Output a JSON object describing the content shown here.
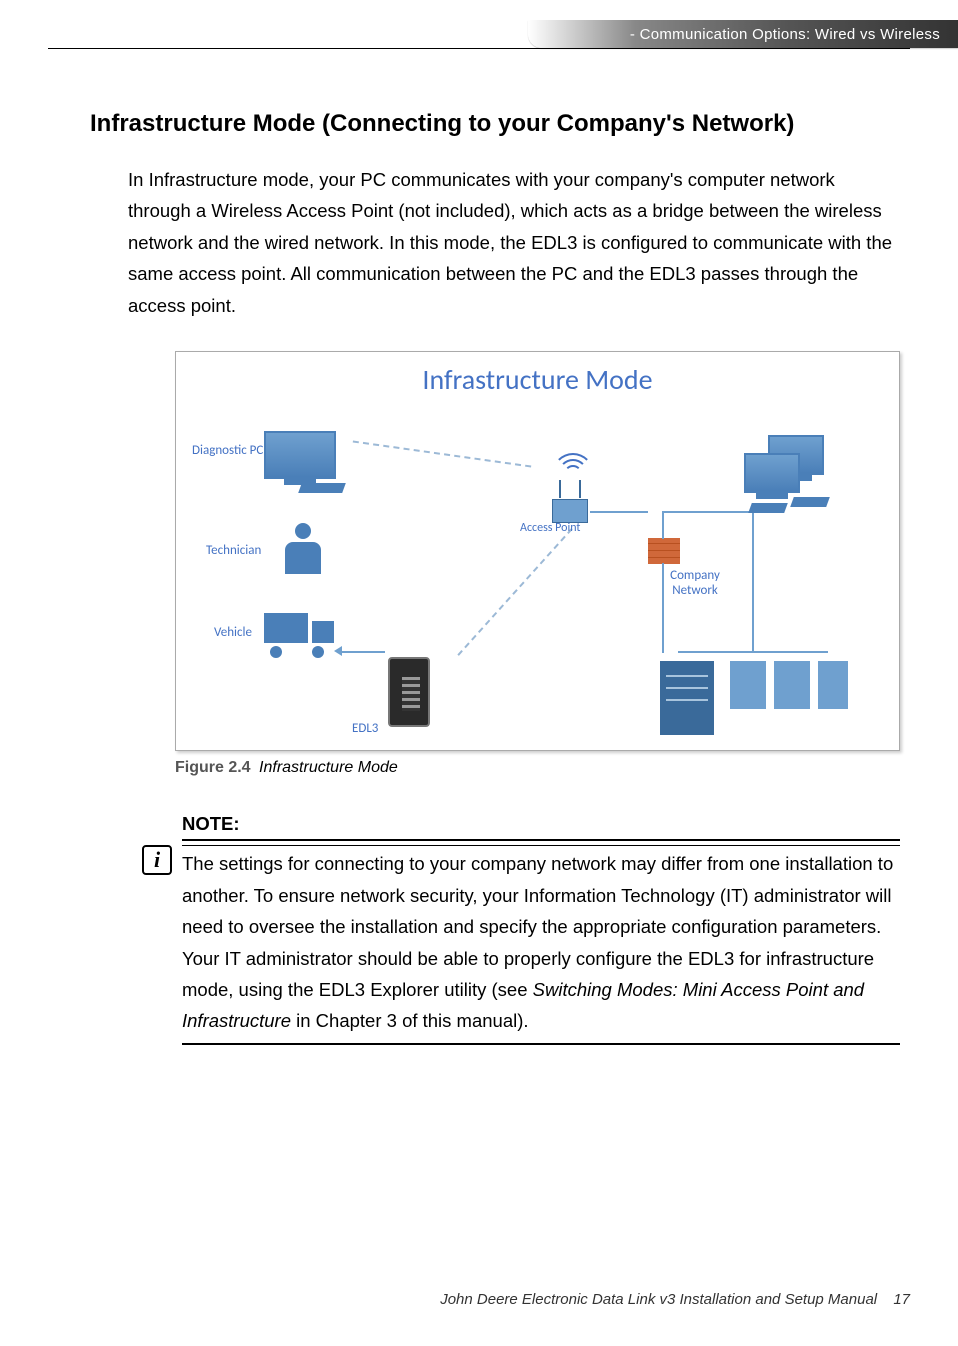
{
  "header": {
    "breadcrumb": "- Communication Options: Wired vs Wireless"
  },
  "section": {
    "title": "Infrastructure Mode (Connecting to your Company's Network)",
    "paragraph": "In Infrastructure mode, your PC communicates with your company's computer network through a Wireless Access Point (not included), which acts as a bridge between the wireless network and the wired network.  In this mode, the EDL3 is configured to communicate with the same access point.  All communication between the PC and the EDL3 passes through the access point."
  },
  "figure": {
    "title": "Infrastructure Mode",
    "labels": {
      "diagnostic_pc": "Diagnostic PC",
      "technician": "Technician",
      "vehicle": "Vehicle",
      "edl3": "EDL3",
      "access_point": "Access Point",
      "company_network": "Company Network"
    },
    "caption_num": "Figure 2.4",
    "caption_text": "Infrastructure Mode"
  },
  "note": {
    "label": "NOTE:",
    "text_pre": "The settings for connecting to your company network may differ from one installation to another. To ensure network security, your Information Technology (IT) administrator will need to oversee the installation and specify the appropriate configuration parameters.  Your IT administrator should be able to properly configure the EDL3 for infrastructure mode, using the EDL3 Explorer utility (see ",
    "text_italic": "Switching Modes: Mini Access Point and Infrastructure",
    "text_post": " in Chapter 3 of this manual)."
  },
  "footer": {
    "manual": "John Deere Electronic Data Link v3 Installation and Setup Manual",
    "page": "17"
  }
}
